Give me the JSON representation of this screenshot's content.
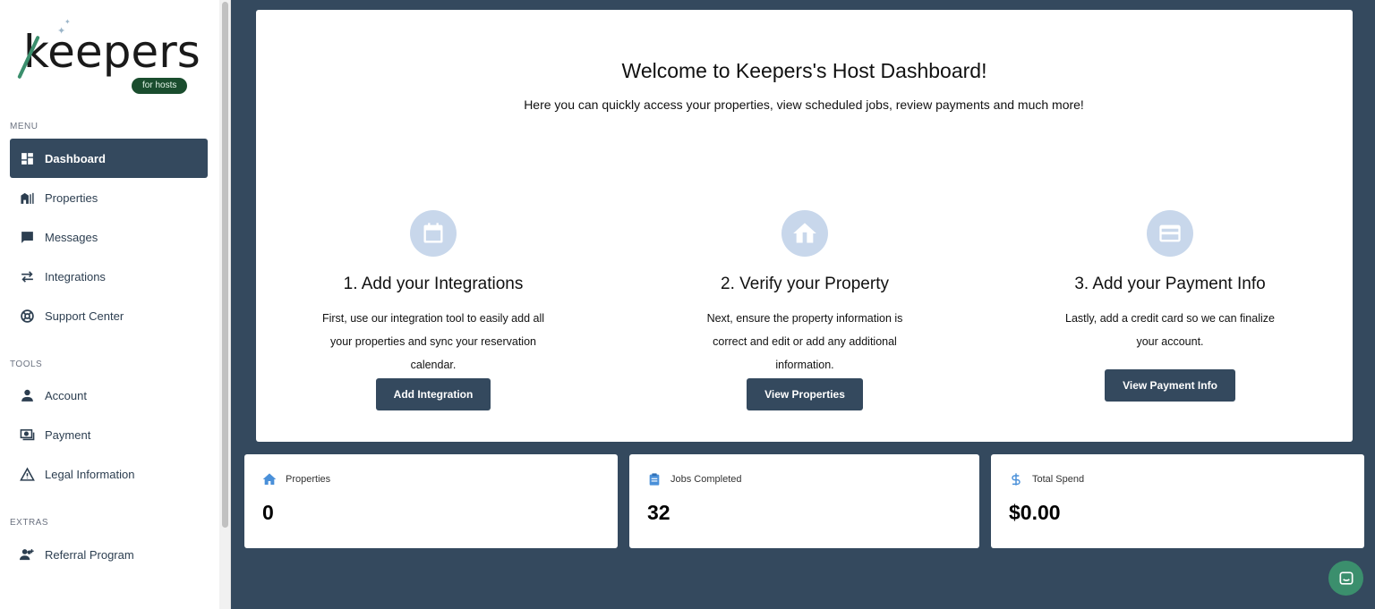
{
  "brand": {
    "name": "keepers",
    "badge": "for hosts"
  },
  "sidebar": {
    "sections": {
      "menu": "MENU",
      "tools": "TOOLS",
      "extras": "EXTRAS"
    },
    "items": [
      {
        "label": "Dashboard",
        "icon": "dashboard-icon"
      },
      {
        "label": "Properties",
        "icon": "buildings-icon"
      },
      {
        "label": "Messages",
        "icon": "chat-bubble-icon"
      },
      {
        "label": "Integrations",
        "icon": "swap-arrows-icon"
      },
      {
        "label": "Support Center",
        "icon": "lifebuoy-icon"
      },
      {
        "label": "Account",
        "icon": "person-icon"
      },
      {
        "label": "Payment",
        "icon": "cash-icon"
      },
      {
        "label": "Legal Information",
        "icon": "warning-triangle-icon"
      },
      {
        "label": "Referral Program",
        "icon": "add-user-icon"
      }
    ]
  },
  "hero": {
    "title": "Welcome to Keepers's Host Dashboard!",
    "subtitle": "Here you can quickly access your properties, view scheduled jobs, review payments and much more!",
    "steps": [
      {
        "title": "1. Add your Integrations",
        "desc": "First, use our integration tool to easily add all your properties and sync your reservation calendar.",
        "button": "Add Integration",
        "icon": "calendar-icon"
      },
      {
        "title": "2. Verify your Property",
        "desc": "Next, ensure the property information is correct and edit or add any additional information.",
        "button": "View Properties",
        "icon": "home-icon"
      },
      {
        "title": "3. Add your Payment Info",
        "desc": "Lastly, add a credit card so we can finalize your account.",
        "button": "View Payment Info",
        "icon": "credit-card-icon"
      }
    ]
  },
  "stats": [
    {
      "label": "Properties",
      "value": "0",
      "icon": "home-icon"
    },
    {
      "label": "Jobs Completed",
      "value": "32",
      "icon": "clipboard-icon"
    },
    {
      "label": "Total Spend",
      "value": "$0.00",
      "icon": "dollar-icon"
    }
  ],
  "colors": {
    "navy": "#34495e",
    "accent_blue": "#4a90d9",
    "green": "#3b8f6d",
    "step_circle": "#c8d7eb"
  }
}
